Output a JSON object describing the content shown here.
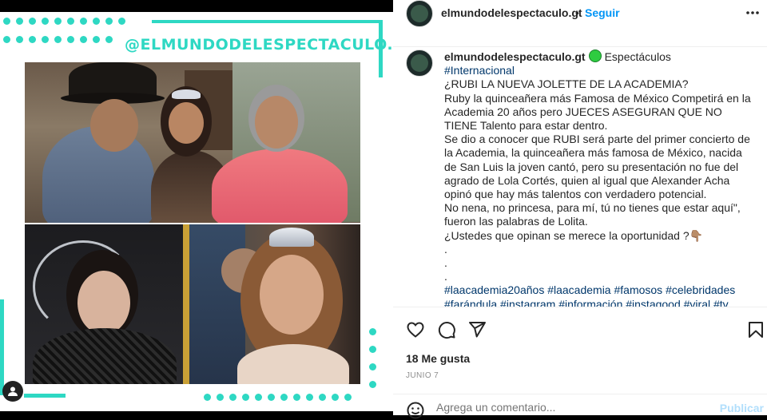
{
  "post_image": {
    "watermark_handle": "@ELMUNDODELESPECTACULO.GT"
  },
  "header": {
    "username": "elmundodelespectaculo.gt",
    "separator": "•",
    "follow_label": "Seguir",
    "more_icon": "more-horizontal-icon"
  },
  "caption": {
    "username": "elmundodelespectaculo.gt",
    "category": "Espectáculos",
    "first_hashtag": "#Internacional",
    "lines": [
      "¿RUBI LA NUEVA JOLETTE DE LA ACADEMIA?",
      "Ruby la quinceañera más Famosa de México Competirá en la Academia 20 años pero JUECES ASEGURAN QUE NO TIENE Talento para estar dentro.",
      "Se dio a conocer que RUBI será parte del primer concierto de la Academia, la quinceañera más famosa de México, nacida de San Luis la joven cantó, pero su presentación no fue del agrado de Lola Cortés, quien al igual que Alexander Acha opinó que hay más talentos con verdadero potencial.",
      "No nena, no princesa, para mí, tú no tienes que estar aquí\", fueron las palabras de Lolita.",
      "¿Ustedes que opinan se merece la oportunidad ?👇🏽",
      ".",
      ".",
      "."
    ],
    "hashtags": "#laacademia20años #laacademia #famosos #celebridades #farándula #instagram #información #instagood #viral #tv"
  },
  "actions": {
    "like_icon": "heart-icon",
    "comment_icon": "comment-icon",
    "share_icon": "send-icon",
    "save_icon": "bookmark-icon",
    "likes": "18 Me gusta",
    "date": "JUNIO 7"
  },
  "comment": {
    "emoji_icon": "emoji-icon",
    "placeholder": "Agrega un comentario...",
    "publish_label": "Publicar"
  },
  "colors": {
    "accent_teal": "#2ed8c3",
    "link_blue": "#0095f6",
    "hashtag_blue": "#00376b"
  }
}
